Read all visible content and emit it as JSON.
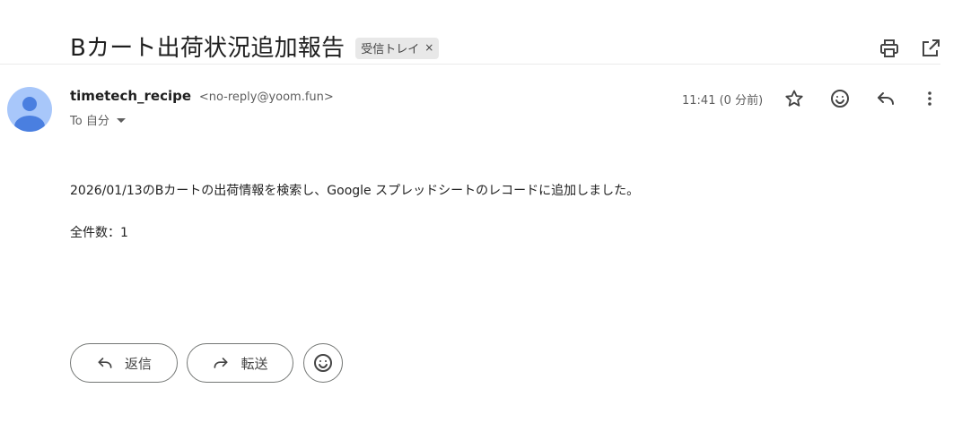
{
  "email": {
    "subject": "Bカート出荷状況追加報告",
    "label": "受信トレイ",
    "label_remove": "×",
    "sender_name": "timetech_recipe",
    "sender_email": "<no-reply@yoom.fun>",
    "to": "To 自分",
    "time": "11:41 (0 分前)",
    "body_line1": "2026/01/13のBカートの出荷情報を検索し、Google スプレッドシートのレコードに追加しました。",
    "body_line2": "全件数：1"
  },
  "actions": {
    "reply_label": "返信",
    "forward_label": "転送"
  },
  "icons": {
    "print": "print-icon",
    "open_new_window": "open-in-new-icon",
    "star": "star-icon",
    "emoji": "emoji-icon",
    "reply": "reply-icon",
    "more": "more-vert-icon",
    "forward": "forward-icon"
  },
  "colors": {
    "avatar_bg": "#a8c7fa",
    "avatar_fg": "#4a7fe0"
  }
}
